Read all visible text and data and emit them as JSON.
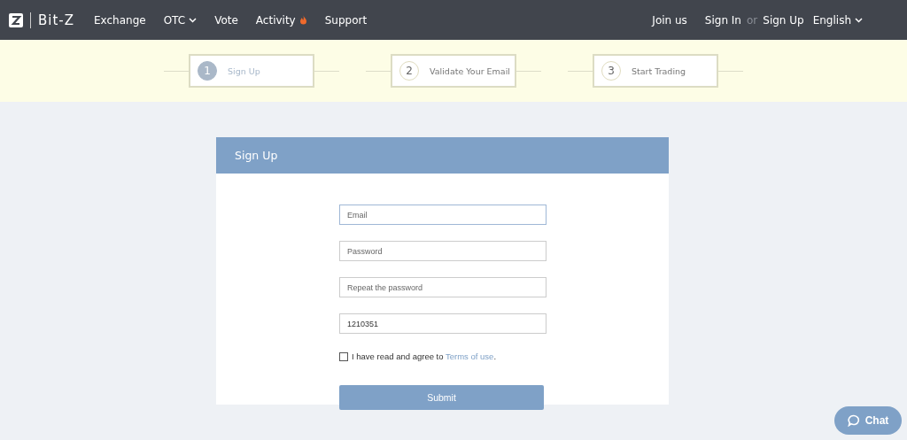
{
  "nav": {
    "brand": "Bit-Z",
    "links": [
      {
        "label": "Exchange",
        "kind": "plain"
      },
      {
        "label": "OTC",
        "kind": "dropdown"
      },
      {
        "label": "Vote",
        "kind": "plain"
      },
      {
        "label": "Activity",
        "kind": "hot"
      },
      {
        "label": "Support",
        "kind": "plain"
      }
    ],
    "right": {
      "join": "Join us",
      "sign_in": "Sign In",
      "or": "or",
      "sign_up": "Sign Up",
      "language": "English"
    }
  },
  "steps": [
    {
      "number": "1",
      "label": "Sign Up",
      "selected": true
    },
    {
      "number": "2",
      "label": "Validate Your Email",
      "selected": false
    },
    {
      "number": "3",
      "label": "Start Trading",
      "selected": false
    }
  ],
  "form": {
    "title": "Sign Up",
    "fields": [
      {
        "placeholder": "Email",
        "focused": true
      },
      {
        "placeholder": "Password",
        "focused": false
      },
      {
        "placeholder": "Repeat the password",
        "focused": false
      },
      {
        "value": "1210351",
        "focused": false
      }
    ],
    "agree": {
      "text": "I have read and agree to",
      "link": "Terms of use",
      "end": ".",
      "checked": false
    },
    "submit": "Submit"
  },
  "chat": "Chat"
}
